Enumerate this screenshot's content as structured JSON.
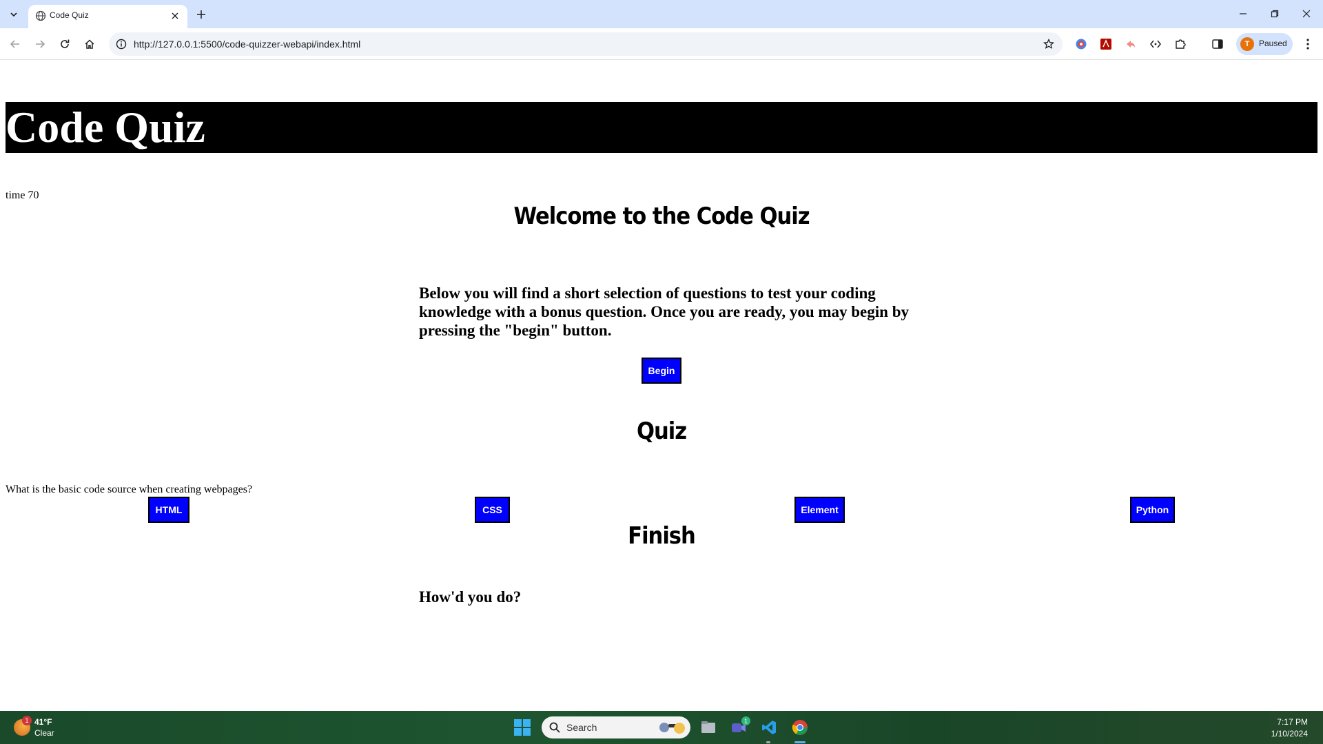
{
  "browser": {
    "tab_title": "Code Quiz",
    "url": "http://127.0.0.1:5500/code-quizzer-webapi/index.html",
    "profile_initial": "T",
    "profile_label": "Paused",
    "icons": [
      "tab-search-icon",
      "globe-icon",
      "close-icon",
      "plus-icon",
      "minimize-icon",
      "restore-icon",
      "back-arrow-icon",
      "forward-arrow-icon",
      "reload-icon",
      "home-icon",
      "info-icon",
      "star-icon",
      "extensions-puzzle-icon",
      "side-panel-icon",
      "kebab-menu-icon"
    ]
  },
  "page": {
    "site_title": "Code Quiz",
    "timer_text": "time 70",
    "welcome_heading": "Welcome to the Code Quiz",
    "intro_text": "Below you will find a short selection of questions to test your coding knowledge with a bonus question. Once you are ready, you may begin by pressing the \"begin\" button.",
    "begin_label": "Begin",
    "quiz_heading": "Quiz",
    "question_text": "What is the basic code source when creating webpages?",
    "answers": [
      "HTML",
      "CSS",
      "Element",
      "Python"
    ],
    "finish_heading": "Finish",
    "finish_text": "How'd you do?",
    "button_color": "#0000ff",
    "header_color": "#000000"
  },
  "taskbar": {
    "weather_temp": "41°F",
    "weather_condition": "Clear",
    "weather_badge": "1",
    "search_label": "Search",
    "teams_badge": "1",
    "clock_time": "7:17 PM",
    "clock_date": "1/10/2024"
  }
}
